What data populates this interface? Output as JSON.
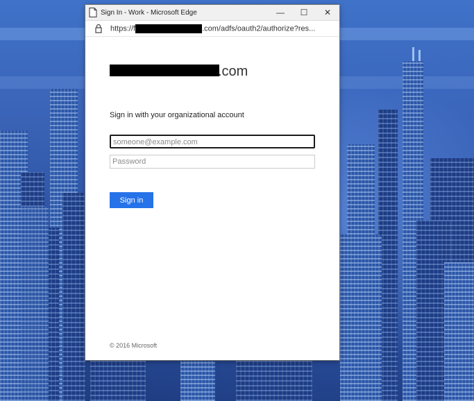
{
  "window": {
    "title": "Sign In - Work - Microsoft Edge",
    "minimize_glyph": "—",
    "maximize_glyph": "☐",
    "close_glyph": "✕",
    "icon": "page-icon"
  },
  "address_bar": {
    "url_prefix": "https://f",
    "url_suffix": ".com/adfs/oauth2/authorize?res...",
    "icon": "lock-icon"
  },
  "signin": {
    "logo_suffix": ".com",
    "heading": "Sign in with your organizational account",
    "email_placeholder": "someone@example.com",
    "password_placeholder": "Password",
    "button_label": "Sign in",
    "footer": "© 2016 Microsoft"
  },
  "colors": {
    "accent": "#2672e8",
    "background": "#2c4f9a"
  }
}
